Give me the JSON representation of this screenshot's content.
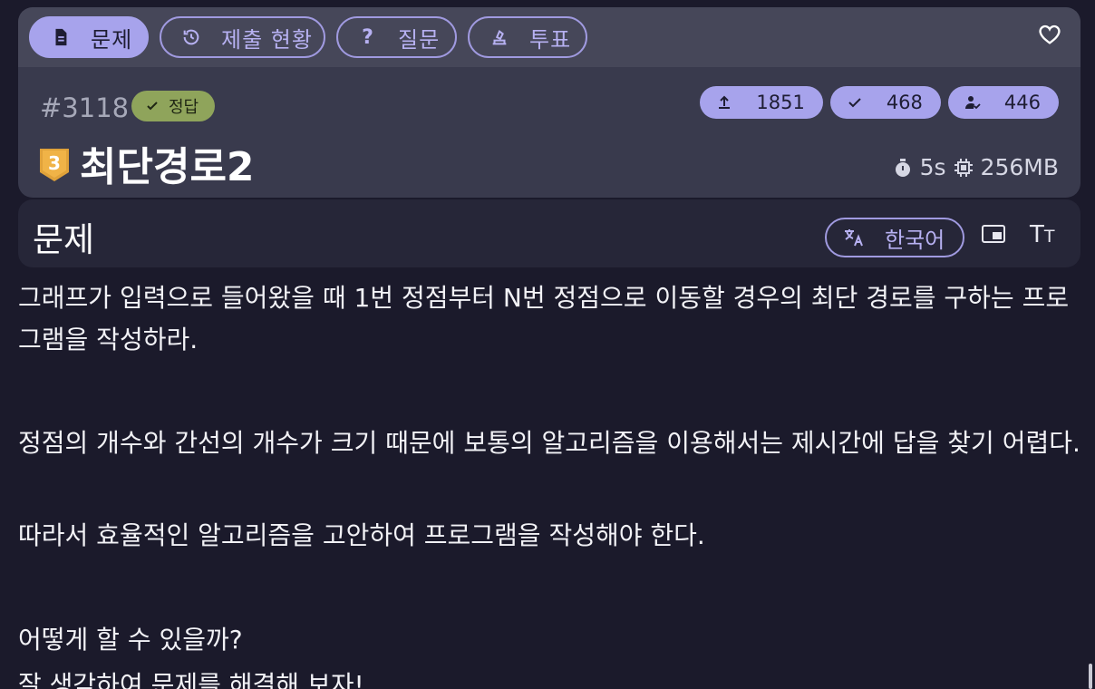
{
  "tabs": [
    {
      "label": "문제",
      "icon": "document-icon",
      "active": true
    },
    {
      "label": "제출 현황",
      "icon": "history-icon",
      "active": false
    },
    {
      "label": "질문",
      "icon": "question-icon",
      "active": false
    },
    {
      "label": "투표",
      "icon": "vote-icon",
      "active": false
    }
  ],
  "problem": {
    "id": "#3118",
    "status": "정답",
    "level": "3",
    "title": "최단경로2",
    "time_limit": "5s",
    "memory_limit": "256MB"
  },
  "stats": {
    "submissions": "1851",
    "accepted": "468",
    "solvers": "446"
  },
  "section": {
    "title": "문제",
    "language": "한국어"
  },
  "content": {
    "p1": "그래프가 입력으로 들어왔을 때 1번 정점부터 N번 정점으로 이동할 경우의 최단 경로를 구하는 프로그램을 작성하라.",
    "p2": "정점의 개수와 간선의 개수가 크기 때문에 보통의 알고리즘을 이용해서는 제시간에 답을 찾기 어렵다.",
    "p3": "따라서 효율적인 알고리즘을 고안하여 프로그램을 작성해야 한다.",
    "p4": "어떻게 할 수 있을까?",
    "p5": "잘 생각하여 문제를 해결해 보자!"
  },
  "colors": {
    "accent": "#a7a3ec",
    "correct": "#8fa45b",
    "level_badge": "#e0a23a",
    "background": "#1b1a2b"
  }
}
